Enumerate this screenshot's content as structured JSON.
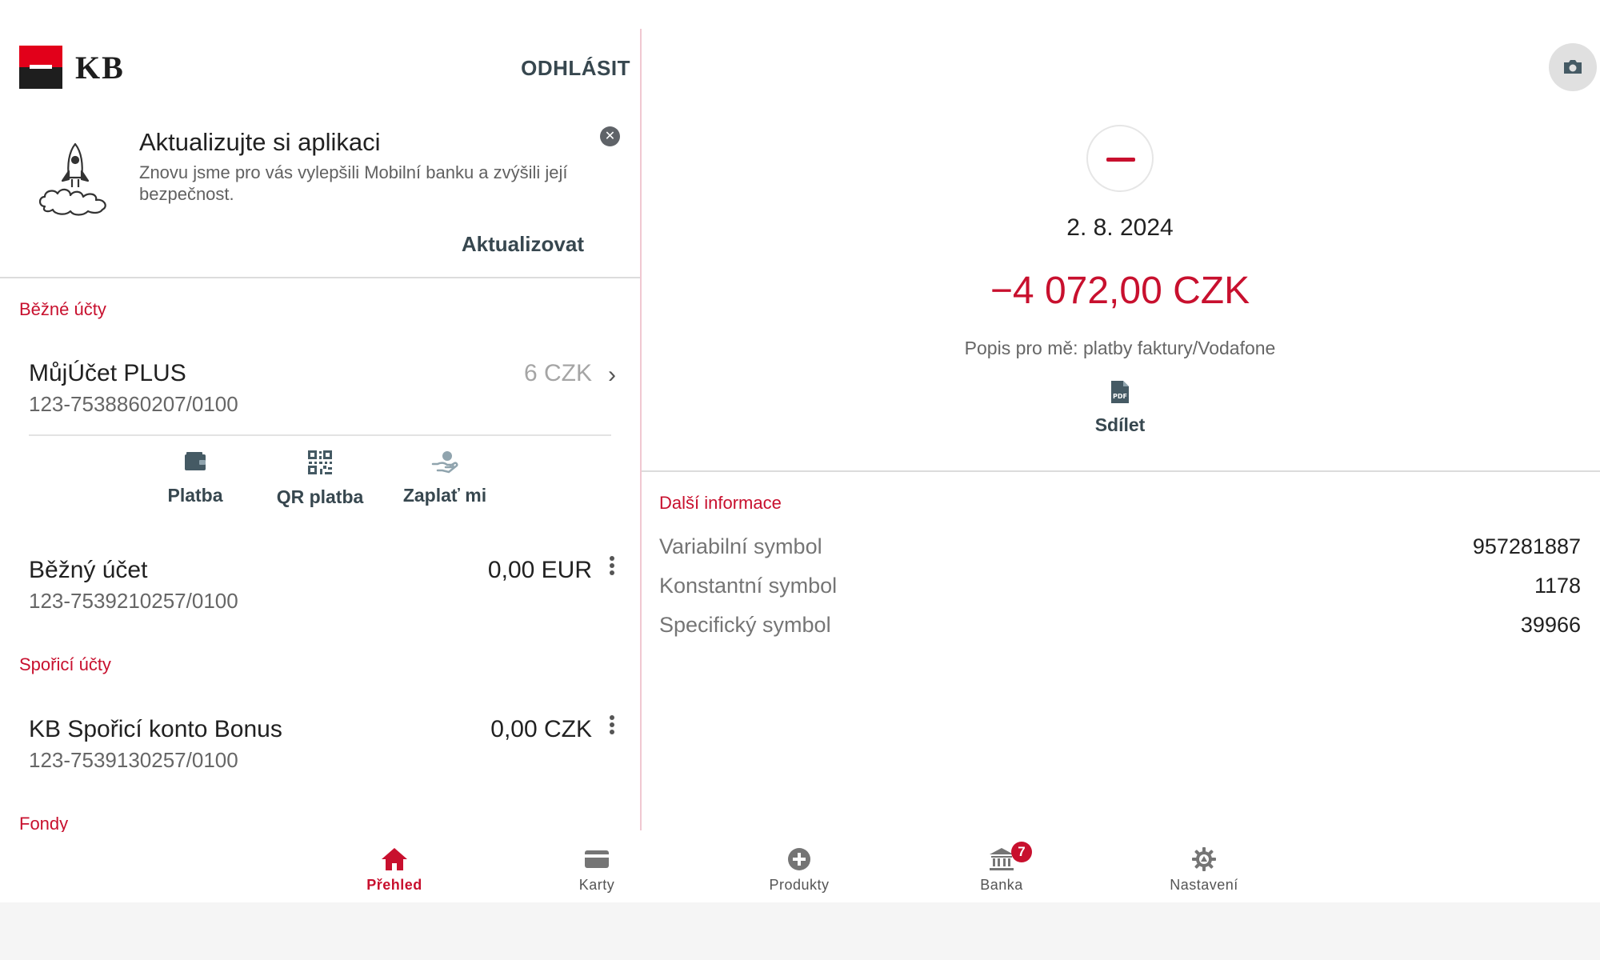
{
  "header": {
    "logo_text": "KB",
    "logout_label": "ODHLÁSIT"
  },
  "banner": {
    "title": "Aktualizujte si aplikaci",
    "text": "Znovu jsme pro vás vylepšili Mobilní banku a zvýšili její bezpečnost.",
    "action_label": "Aktualizovat",
    "close_icon": "close-icon"
  },
  "sections": {
    "current": "Běžné účty",
    "savings": "Spořicí účty",
    "funds": "Fondy"
  },
  "accounts": [
    {
      "name": "MůjÚčet PLUS",
      "number": "123-7538860207/0100",
      "balance": "6 CZK"
    },
    {
      "name": "Běžný účet",
      "number": "123-7539210257/0100",
      "balance": "0,00 EUR"
    },
    {
      "name": "KB Spořicí konto Bonus",
      "number": "123-7539130257/0100",
      "balance": "0,00 CZK"
    }
  ],
  "quick_actions": [
    {
      "label": "Platba",
      "icon": "wallet-icon"
    },
    {
      "label": "QR platba",
      "icon": "qr-code-icon"
    },
    {
      "label": "Zaplať mi",
      "icon": "request-money-icon"
    }
  ],
  "transaction": {
    "date": "2. 8. 2024",
    "amount": "−4 072,00 CZK",
    "description": "Popis pro mě: platby faktury/Vodafone",
    "share_label": "Sdílet",
    "share_icon": "pdf-icon",
    "more_title": "Další informace",
    "details": [
      {
        "label": "Variabilní symbol",
        "value": "957281887"
      },
      {
        "label": "Konstantní symbol",
        "value": "1178"
      },
      {
        "label": "Specifický symbol",
        "value": "39966"
      }
    ]
  },
  "nav": [
    {
      "label": "Přehled",
      "icon": "home-icon",
      "active": true
    },
    {
      "label": "Karty",
      "icon": "card-icon"
    },
    {
      "label": "Produkty",
      "icon": "plus-circle-icon"
    },
    {
      "label": "Banka",
      "icon": "bank-icon",
      "badge": "7"
    },
    {
      "label": "Nastavení",
      "icon": "gear-icon"
    }
  ],
  "colors": {
    "brand": "#c8102e",
    "logo_red": "#e2001a",
    "text_dark": "#37474f"
  }
}
